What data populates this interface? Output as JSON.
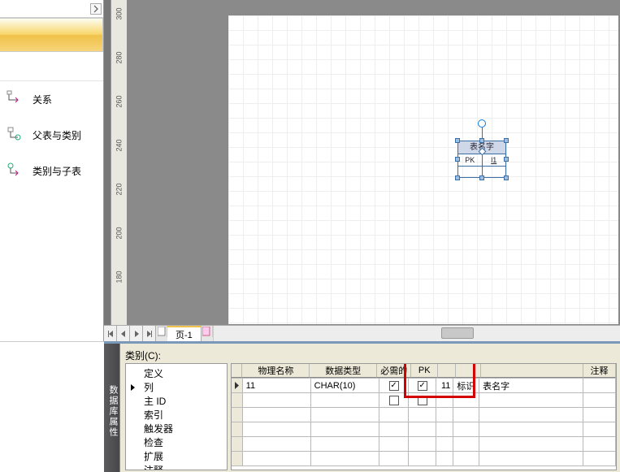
{
  "stencil": {
    "items": [
      {
        "name": "relation",
        "label": "关系"
      },
      {
        "name": "parent-category",
        "label": "父表与类别"
      },
      {
        "name": "category-child",
        "label": "类别与子表"
      }
    ]
  },
  "ruler": {
    "marks": [
      "300",
      "280",
      "260",
      "240",
      "220",
      "200",
      "180"
    ]
  },
  "entity": {
    "title": "表名字",
    "col1": "PK",
    "col2": "l1"
  },
  "page_tab": "页-1",
  "properties": {
    "side_tab": "数据库属性",
    "category_label": "类别(C):",
    "tree": [
      "定义",
      "列",
      "主 ID",
      "索引",
      "触发器",
      "检查",
      "扩展",
      "注释"
    ],
    "headers": {
      "phys": "物理名称",
      "type": "数据类型",
      "req": "必需的",
      "pk": "PK",
      "comment": "注释"
    },
    "row": {
      "id": "11",
      "type": "CHAR(10)",
      "req": true,
      "pk": true,
      "num": "11",
      "ident": "标识",
      "ref": "表名字"
    }
  }
}
